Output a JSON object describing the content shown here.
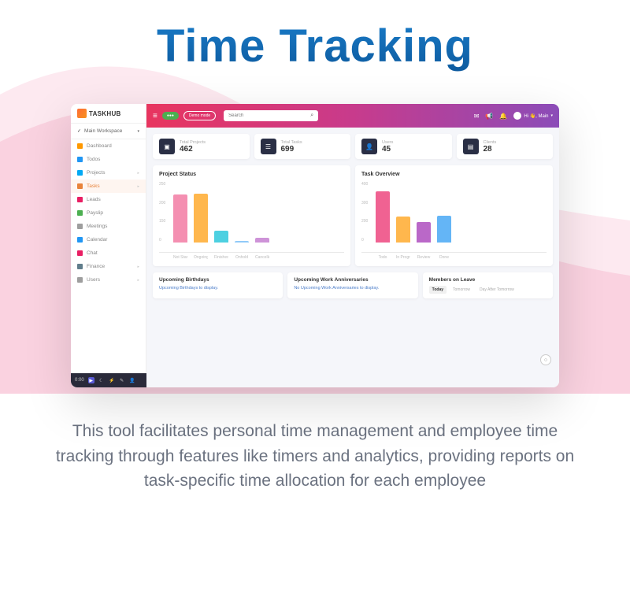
{
  "page": {
    "title": "Time Tracking",
    "description": "This tool facilitates personal time management and employee time tracking through features like timers and analytics, providing reports on task-specific time allocation for each employee"
  },
  "logo": {
    "text": "TASKHUB"
  },
  "workspace": {
    "label": "Main Workspace"
  },
  "sidebar": {
    "items": [
      {
        "label": "Dashboard",
        "color": "#ff9800"
      },
      {
        "label": "Todos",
        "color": "#2196f3"
      },
      {
        "label": "Projects",
        "color": "#03a9f4"
      },
      {
        "label": "Tasks",
        "color": "#e8833a"
      },
      {
        "label": "Leads",
        "color": "#e91e63"
      },
      {
        "label": "Payslip",
        "color": "#4caf50"
      },
      {
        "label": "Meetings",
        "color": "#9e9e9e"
      },
      {
        "label": "Calendar",
        "color": "#2196f3"
      },
      {
        "label": "Chat",
        "color": "#e91e63"
      },
      {
        "label": "Finance",
        "color": "#607d8b"
      },
      {
        "label": "Users",
        "color": "#9e9e9e"
      }
    ],
    "active_index": 3
  },
  "topbar": {
    "badge_green": "●",
    "badge_demo": "Demo mode",
    "search_placeholder": "Search",
    "user_greet": "Hi 👋, Main"
  },
  "stats": [
    {
      "label": "Total Projects",
      "value": "462",
      "icon_bg": "#2a2f45",
      "icon": "folder"
    },
    {
      "label": "Total Tasks",
      "value": "699",
      "icon_bg": "#2a2f45",
      "icon": "list"
    },
    {
      "label": "Users",
      "value": "45",
      "icon_bg": "#2a2f45",
      "icon": "user"
    },
    {
      "label": "Clients",
      "value": "28",
      "icon_bg": "#2a2f45",
      "icon": "file"
    }
  ],
  "charts": {
    "project_status": {
      "title": "Project Status"
    },
    "task_overview": {
      "title": "Task Overview"
    }
  },
  "chart_data": [
    {
      "type": "bar",
      "title": "Project Status",
      "ylim": [
        0,
        250
      ],
      "ticks": [
        "250",
        "200",
        "150",
        "0"
      ],
      "categories": [
        "Not Started",
        "Ongoing",
        "Finished",
        "Onhold",
        "Cancelled"
      ],
      "values": [
        195,
        200,
        48,
        8,
        18
      ],
      "colors": [
        "#f48fb1",
        "#ffb74d",
        "#4dd0e1",
        "#90caf9",
        "#ce93d8"
      ]
    },
    {
      "type": "bar",
      "title": "Task Overview",
      "ylim": [
        0,
        400
      ],
      "ticks": [
        "400",
        "300",
        "200",
        "0"
      ],
      "categories": [
        "Todo",
        "In Progress",
        "Review",
        "Done"
      ],
      "values": [
        335,
        170,
        135,
        175
      ],
      "colors": [
        "#f06292",
        "#ffb74d",
        "#ba68c8",
        "#64b5f6"
      ]
    }
  ],
  "bottom": {
    "birthdays": {
      "title": "Upcoming Birthdays",
      "msg": "Upcoming Birthdays to display."
    },
    "anniversaries": {
      "title": "Upcoming Work Anniversaries",
      "msg": "No Upcoming Work Anniversaries to display."
    },
    "leave": {
      "title": "Members on Leave",
      "tabs": [
        "Today",
        "Tomorrow",
        "Day After Tomorrow"
      ],
      "active": 0
    }
  },
  "taskbar": {
    "time": "0:00"
  }
}
